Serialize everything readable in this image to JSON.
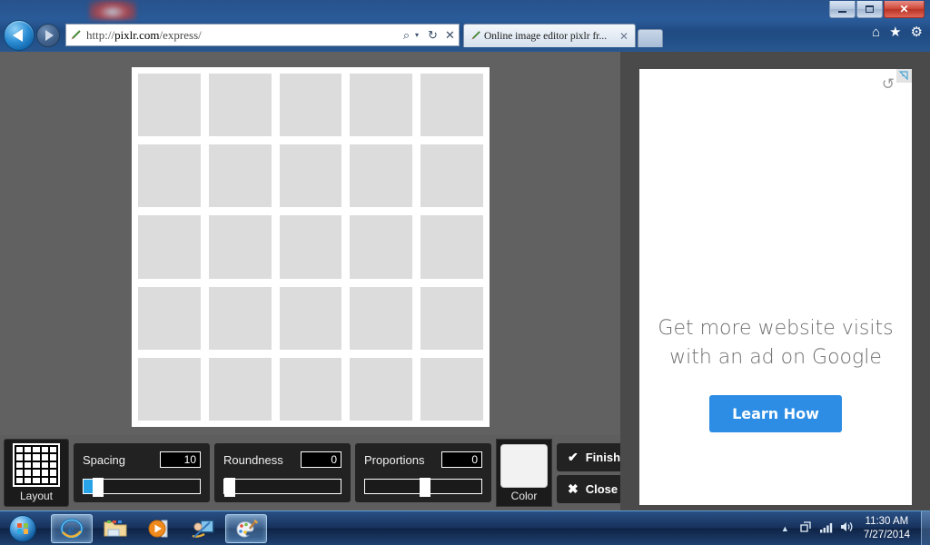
{
  "browser": {
    "window_controls": {
      "minimize": "minimize",
      "maximize": "maximize",
      "close": "✕"
    },
    "nav": {
      "back": "back-arrow",
      "forward": "forward-arrow"
    },
    "address": {
      "favicon": "paintbrush-icon",
      "url_prefix": "http://",
      "url_domain": "pixlr.com",
      "url_path": "/express/",
      "url_full": "http://pixlr.com/express/",
      "search_icon": "⌕",
      "search_caret": "▾",
      "refresh_icon": "↻",
      "stop_icon": "✕"
    },
    "tab": {
      "favicon": "paintbrush-icon",
      "title": "Online image editor pixlr fr...",
      "close": "✕"
    },
    "tools": {
      "home": "⌂",
      "favorites": "★",
      "settings": "⚙"
    }
  },
  "editor": {
    "collage": {
      "columns": 5,
      "rows": 5,
      "cell_count": 25,
      "cell_color": "#dcdcdc",
      "background_color": "#ffffff"
    },
    "toolbar": {
      "layout": {
        "label": "Layout",
        "thumb_columns": 5,
        "thumb_rows": 5
      },
      "controls": [
        {
          "label": "Spacing",
          "value": "10",
          "fill_percent": 8,
          "handle_percent": 8
        },
        {
          "label": "Roundness",
          "value": "0",
          "fill_percent": 0,
          "handle_percent": 0
        },
        {
          "label": "Proportions",
          "value": "0",
          "fill_percent": 0,
          "handle_percent": 50
        }
      ],
      "color": {
        "label": "Color",
        "swatch_hex": "#f2f2f2"
      },
      "actions": [
        {
          "label": "Finish",
          "glyph": "✔"
        },
        {
          "label": "Close",
          "glyph": "✖"
        }
      ]
    }
  },
  "ad": {
    "choices_icon": "adchoices-icon",
    "refresh_icon": "↺",
    "headline_line1": "Get more website visits",
    "headline_line2": "with an ad on Google",
    "cta_label": "Learn How",
    "cta_color": "#2d8de4"
  },
  "taskbar": {
    "start": "start-orb",
    "buttons": [
      {
        "name": "internet-explorer",
        "active": true
      },
      {
        "name": "windows-explorer",
        "active": false
      },
      {
        "name": "windows-media-player",
        "active": false
      },
      {
        "name": "snipping-tool",
        "active": false
      },
      {
        "name": "paint",
        "active": true
      }
    ],
    "tray": {
      "show_hidden_arrow": "▲",
      "action_center_icon": "⚑",
      "network_icon": "signal-bars-icon",
      "volume_icon": "🔊",
      "time": "11:30 AM",
      "date": "7/27/2014"
    }
  }
}
